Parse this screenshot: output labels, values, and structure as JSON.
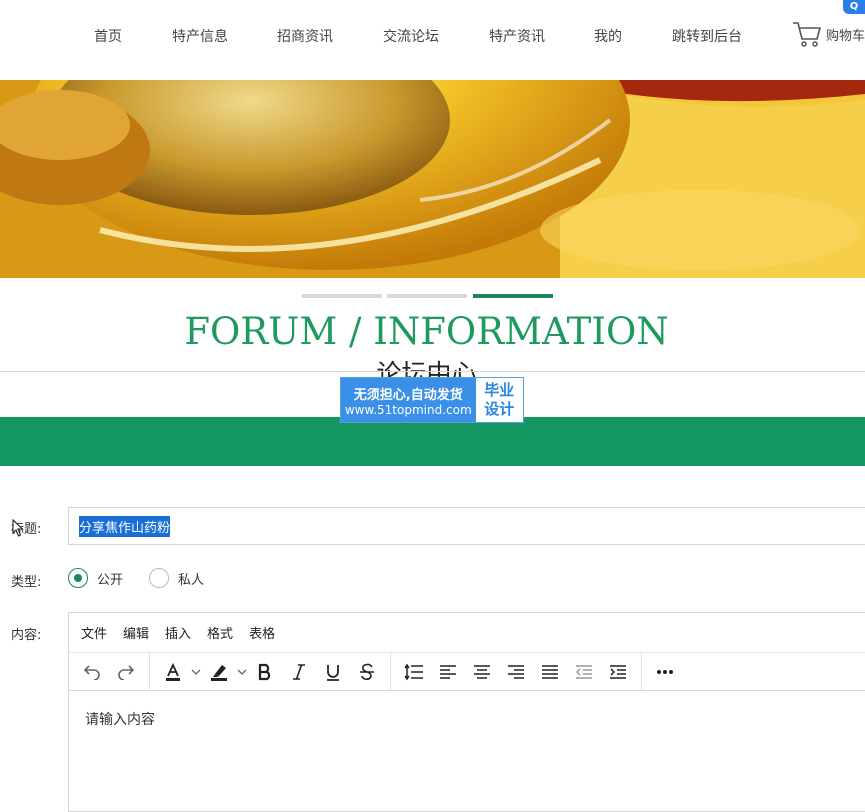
{
  "nav": {
    "items": [
      {
        "label": "首页"
      },
      {
        "label": "特产信息"
      },
      {
        "label": "招商资讯"
      },
      {
        "label": "交流论坛"
      },
      {
        "label": "特产资讯"
      },
      {
        "label": "我的"
      },
      {
        "label": "跳转到后台"
      }
    ],
    "cart_label": "购物车",
    "corner_badge": "Q"
  },
  "carousel": {
    "slides": 3,
    "active_index": 2
  },
  "section": {
    "title_en": "FORUM / INFORMATION",
    "title_cn": "论坛中心"
  },
  "watermark": {
    "line1": "无须担心,自动发货",
    "line2": "www.51topmind.com",
    "right_line1": "毕业",
    "right_line2": "设计"
  },
  "form": {
    "title_label": "标题:",
    "title_value": "分享焦作山药粉",
    "type_label": "类型:",
    "type_options": [
      {
        "label": "公开",
        "checked": true
      },
      {
        "label": "私人",
        "checked": false
      }
    ],
    "content_label": "内容:",
    "editor": {
      "menus": [
        "文件",
        "编辑",
        "插入",
        "格式",
        "表格"
      ],
      "placeholder": "请输入内容"
    }
  },
  "colors": {
    "accent_green": "#13965f",
    "heading_green": "#1f9a5e",
    "selection_blue": "#1a6fd6",
    "watermark_blue": "#3a8fe6"
  }
}
